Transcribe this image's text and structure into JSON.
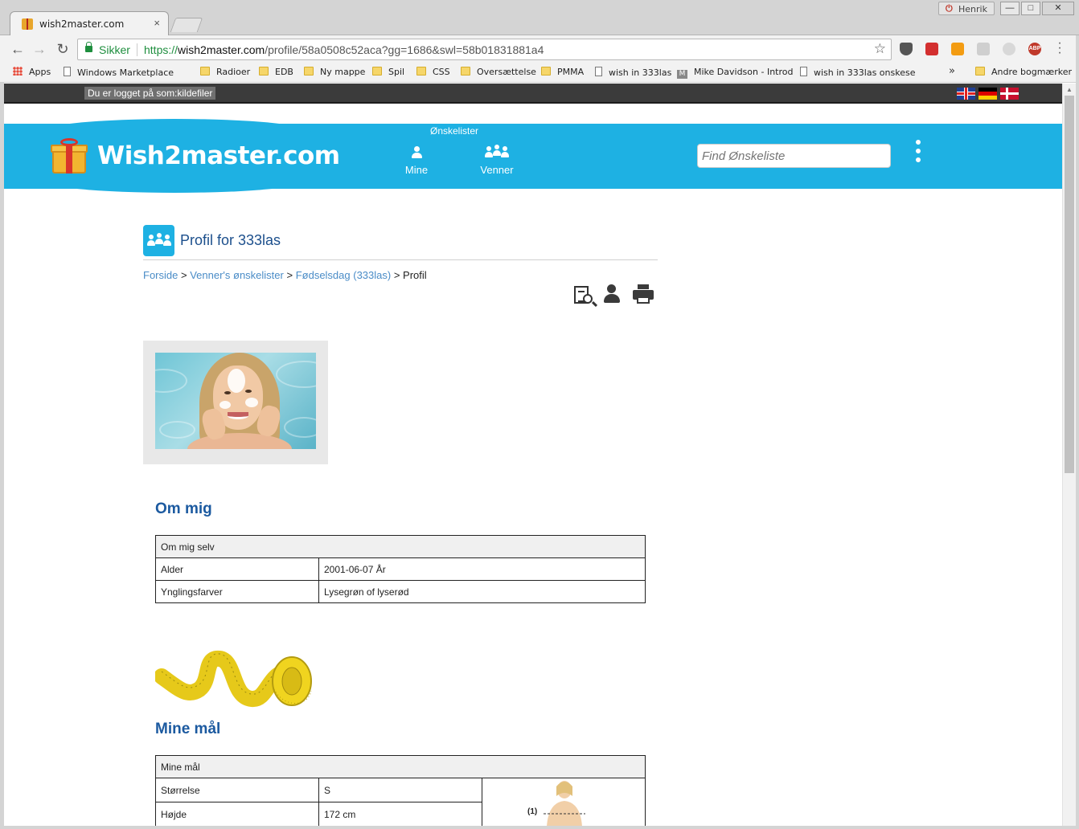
{
  "browser": {
    "tab_title": "wish2master.com",
    "tab_close": "×",
    "user_name": "Henrik",
    "omnibox": {
      "secure_label": "Sikker",
      "url_scheme": "https://",
      "url_host": "wish2master.com",
      "url_path": "/profile/58a0508c52aca?gg=1686&swl=58b01831881a4"
    },
    "bookmarks": [
      {
        "label": "Apps",
        "icon": "apps-icon"
      },
      {
        "label": "Windows Marketplace",
        "icon": "page-icon"
      },
      {
        "label": "Radioer",
        "icon": "folder-icon"
      },
      {
        "label": "EDB",
        "icon": "folder-icon"
      },
      {
        "label": "Ny mappe",
        "icon": "folder-icon"
      },
      {
        "label": "Spil",
        "icon": "folder-icon"
      },
      {
        "label": "CSS",
        "icon": "folder-icon"
      },
      {
        "label": "Oversættelse",
        "icon": "folder-icon"
      },
      {
        "label": "PMMA",
        "icon": "folder-icon"
      },
      {
        "label": "wish in 333las",
        "icon": "page-icon"
      },
      {
        "label": "Mike Davidson - Introd",
        "icon": "m-icon"
      },
      {
        "label": "wish in 333las onskese",
        "icon": "page-icon"
      },
      {
        "label": "Andre bogmærker",
        "icon": "folder-icon"
      }
    ],
    "bookmarks_more": "»"
  },
  "site": {
    "login_status": "Du er logget på som:kildefiler",
    "languages": [
      "en",
      "de",
      "da"
    ],
    "logo_text": "Wish2master.com",
    "nav_title": "Ønskelister",
    "nav_items": [
      {
        "label": "Mine"
      },
      {
        "label": "Venner"
      }
    ],
    "search_placeholder": "Find Ønskeliste",
    "brand_color": "#1eb1e3"
  },
  "page": {
    "title": "Profil for 333las",
    "breadcrumb": {
      "items": [
        "Forside",
        "Venner's ønskelister",
        "Fødselsdag (333las)"
      ],
      "separator": ">",
      "current": "Profil"
    },
    "about": {
      "heading": "Om mig",
      "table_header": "Om mig selv",
      "rows": [
        {
          "label": "Alder",
          "value": "2001-06-07 År"
        },
        {
          "label": "Ynglingsfarver",
          "value": "Lysegrøn of lyserød"
        }
      ]
    },
    "measures": {
      "heading": "Mine mål",
      "table_header": "Mine mål",
      "rows": [
        {
          "label": "Størrelse",
          "value": "S"
        },
        {
          "label": "Højde",
          "value": "172 cm"
        }
      ],
      "figure_label": "(1)"
    }
  }
}
